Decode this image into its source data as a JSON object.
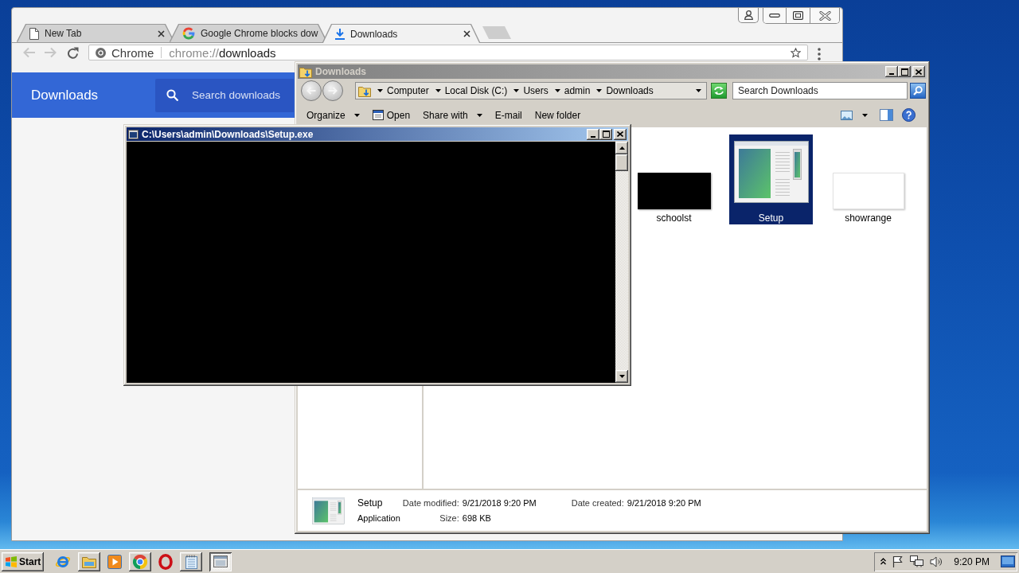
{
  "browser_window": {
    "tabs": [
      {
        "title": "New Tab",
        "kind": "page",
        "selected": false
      },
      {
        "title": "Google Chrome blocks dow",
        "kind": "google",
        "selected": false
      },
      {
        "title": "Downloads",
        "kind": "download",
        "selected": true
      }
    ],
    "navigation": [
      {
        "kind": "back",
        "disabled": true
      },
      {
        "kind": "forward",
        "disabled": true
      },
      {
        "kind": "reload",
        "disabled": false
      }
    ],
    "omnibox": {
      "chip": "Chrome",
      "scheme": "chrome://",
      "path": "downloads"
    },
    "page": {
      "title": "Downloads",
      "search": {
        "placeholder": "Search downloads"
      }
    }
  },
  "explorer_window": {
    "title": "Downloads",
    "active": false,
    "breadcrumb": [
      "Computer",
      "Local Disk (C:)",
      "Users",
      "admin",
      "Downloads"
    ],
    "search": {
      "placeholder": "Search Downloads"
    },
    "commands": [
      {
        "label": "Organize",
        "kind": "menu"
      },
      {
        "label": "Open",
        "kind": "open"
      },
      {
        "label": "Share with",
        "kind": "menu"
      },
      {
        "label": "E-mail",
        "kind": "plain"
      },
      {
        "label": "New folder",
        "kind": "plain"
      }
    ],
    "files": [
      {
        "name": "schoolst",
        "kind": "dark",
        "selected": false
      },
      {
        "name": "Setup",
        "kind": "app",
        "selected": true
      },
      {
        "name": "showrange",
        "kind": "blank",
        "selected": false
      }
    ],
    "details": {
      "name": "Setup",
      "type": "Application",
      "fields": [
        {
          "label": "Date modified:",
          "value": "9/21/2018 9:20 PM"
        },
        {
          "label": "Date created:",
          "value": "9/21/2018 9:20 PM"
        },
        {
          "label": "Size:",
          "value": "698 KB"
        }
      ]
    }
  },
  "console_window": {
    "title": "C:\\Users\\admin\\Downloads\\Setup.exe",
    "active": true
  },
  "taskbar": {
    "start": "Start",
    "apps": [
      {
        "kind": "ie",
        "running": false,
        "selected": false
      },
      {
        "kind": "explorer",
        "running": true,
        "selected": false
      },
      {
        "kind": "media",
        "running": false,
        "selected": false
      },
      {
        "kind": "chrome",
        "running": true,
        "selected": false
      },
      {
        "kind": "opera",
        "running": false,
        "selected": false
      },
      {
        "kind": "notepad",
        "running": true,
        "selected": false
      },
      {
        "kind": "console",
        "running": true,
        "selected": true
      }
    ],
    "clock": "9:20 PM"
  }
}
